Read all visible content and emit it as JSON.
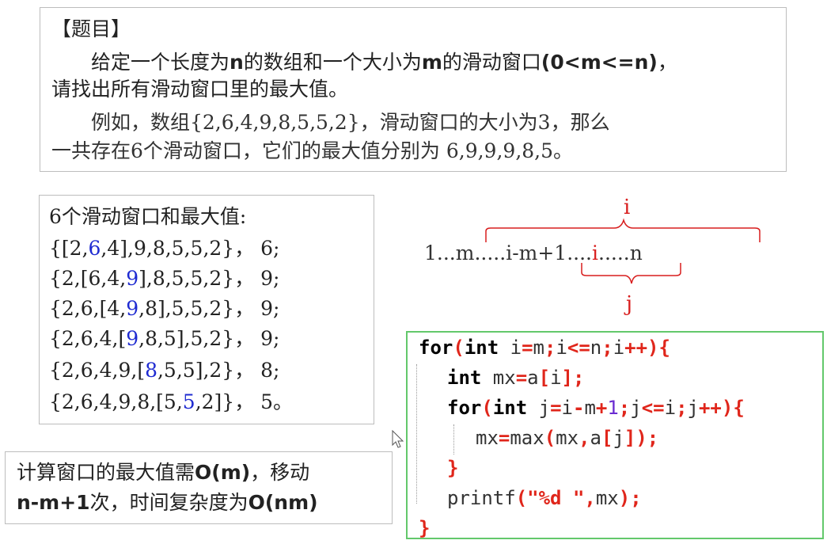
{
  "problem": {
    "heading": "【题目】",
    "line1": "给定一个长度为",
    "n": "n",
    "line1b": "的数组和一个大小为",
    "m": "m",
    "line1c": "的滑动窗口",
    "cond": "(0<m<=n)",
    "line1d": "，",
    "line2": "请找出所有滑动窗口里的最大值。",
    "line3": "例如，数组{2,6,4,9,8,5,5,2}，滑动窗口的大小为3，那么",
    "line4": "一共存在6个滑动窗口，它们的最大值分别为 6,9,9,9,8,5。"
  },
  "windows": {
    "title": "6个滑动窗口和最大值:",
    "rows": [
      {
        "a": "{[2,",
        "b": "6",
        "c": ",4],9,8,5,5,2}， 6;"
      },
      {
        "a": "{2,[6,4,",
        "b": "9",
        "c": "],8,5,5,2}， 9;"
      },
      {
        "a": "{2,6,[4,",
        "b": "9",
        "c": ",8],5,5,2}， 9;"
      },
      {
        "a": "{2,6,4,[",
        "b": "9",
        "c": ",8,5],5,2}， 9;"
      },
      {
        "a": "{2,6,4,9,[",
        "b": "8",
        "c": ",5,5],2}， 8;"
      },
      {
        "a": "{2,6,4,9,8,[5,",
        "b": "5",
        "c": ",2]}， 5。"
      }
    ]
  },
  "complexity": {
    "l1a": "计算窗口的最大值需",
    "l1b": "O(m)",
    "l1c": "，移动",
    "l2a": "n-m+1",
    "l2b": "次，时间复杂度为",
    "l2c": "O(nm)"
  },
  "diagram": {
    "top_label": "i",
    "bottom_label": "j",
    "seq_1": "1...",
    "seq_m": "m",
    "seq_dots1": ".....",
    "seq_im1": "i-m+1",
    "seq_dots2": "....",
    "seq_i": "i",
    "seq_dots3": ".....",
    "seq_n": "n",
    "colors": {
      "red": "#d81e1e",
      "text": "#333333"
    }
  },
  "code": {
    "lines": [
      "for(int i=m;i<=n;i++){",
      "int mx=a[i];",
      "for(int j=i-m+1;j<=i;j++){",
      "mx=max(mx,a[j]);",
      "}",
      "printf(\"%d \",mx);",
      "}"
    ],
    "border_color": "#63c86b"
  }
}
